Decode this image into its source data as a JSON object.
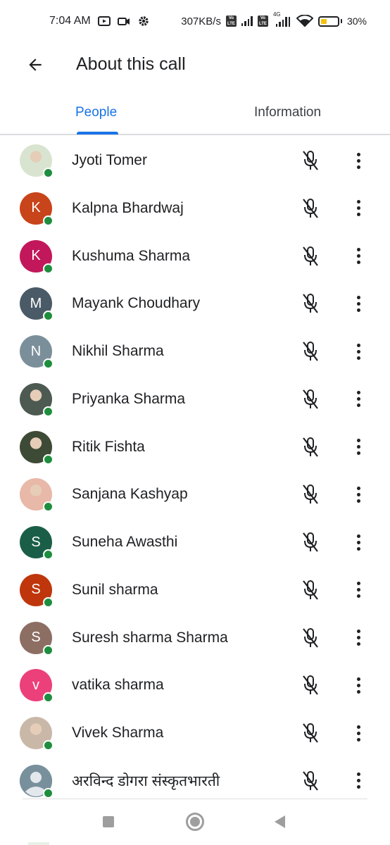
{
  "status_bar": {
    "time": "7:04 AM",
    "speed": "307KB/s",
    "volte1": "Vo LTE",
    "volte2": "Vo LTE",
    "net_type": "4G",
    "battery_percent": "30%",
    "battery_level": 0.3,
    "icons": [
      "youtube-icon",
      "video-camera-icon",
      "gear-icon",
      "wifi-icon"
    ]
  },
  "header": {
    "back_icon": "arrow-back-icon",
    "title": "About this call"
  },
  "tabs": [
    {
      "label": "People",
      "active": true
    },
    {
      "label": "Information",
      "active": false
    }
  ],
  "colors": {
    "accent": "#1a73e8",
    "online": "#1e8e3e"
  },
  "participants": [
    {
      "name": "Jyoti Tomer",
      "initial": "",
      "avatar": "photo",
      "color": "#d9e4d0"
    },
    {
      "name": "Kalpna Bhardwaj",
      "initial": "K",
      "avatar": "letter",
      "color": "#c8441a"
    },
    {
      "name": "Kushuma Sharma",
      "initial": "K",
      "avatar": "letter",
      "color": "#c2185b"
    },
    {
      "name": "Mayank Choudhary",
      "initial": "M",
      "avatar": "letter",
      "color": "#4a5a66"
    },
    {
      "name": "Nikhil Sharma",
      "initial": "N",
      "avatar": "letter",
      "color": "#7b8f9b"
    },
    {
      "name": "Priyanka Sharma",
      "initial": "",
      "avatar": "photo",
      "color": "#4c5a52"
    },
    {
      "name": "Ritik Fishta",
      "initial": "",
      "avatar": "photo",
      "color": "#3d4a35"
    },
    {
      "name": "Sanjana Kashyap",
      "initial": "",
      "avatar": "photo",
      "color": "#e8b8a8"
    },
    {
      "name": "Suneha Awasthi",
      "initial": "S",
      "avatar": "letter",
      "color": "#1b5e48"
    },
    {
      "name": "Sunil sharma",
      "initial": "S",
      "avatar": "letter",
      "color": "#bf360c"
    },
    {
      "name": "Suresh sharma Sharma",
      "initial": "S",
      "avatar": "letter",
      "color": "#8d6e63"
    },
    {
      "name": "vatika sharma",
      "initial": "v",
      "avatar": "letter",
      "color": "#ec407a"
    },
    {
      "name": "Vivek Sharma",
      "initial": "",
      "avatar": "photo",
      "color": "#c9b8a8"
    },
    {
      "name": "अरविन्द डोगरा संस्कृतभारती",
      "initial": "",
      "avatar": "default",
      "color": "#78909c"
    }
  ],
  "row_icons": {
    "mic": "mic-off-icon",
    "more": "more-vertical-icon"
  },
  "nav_bar": {
    "icons": [
      "recents-square-icon",
      "home-circle-icon",
      "back-triangle-icon"
    ]
  }
}
